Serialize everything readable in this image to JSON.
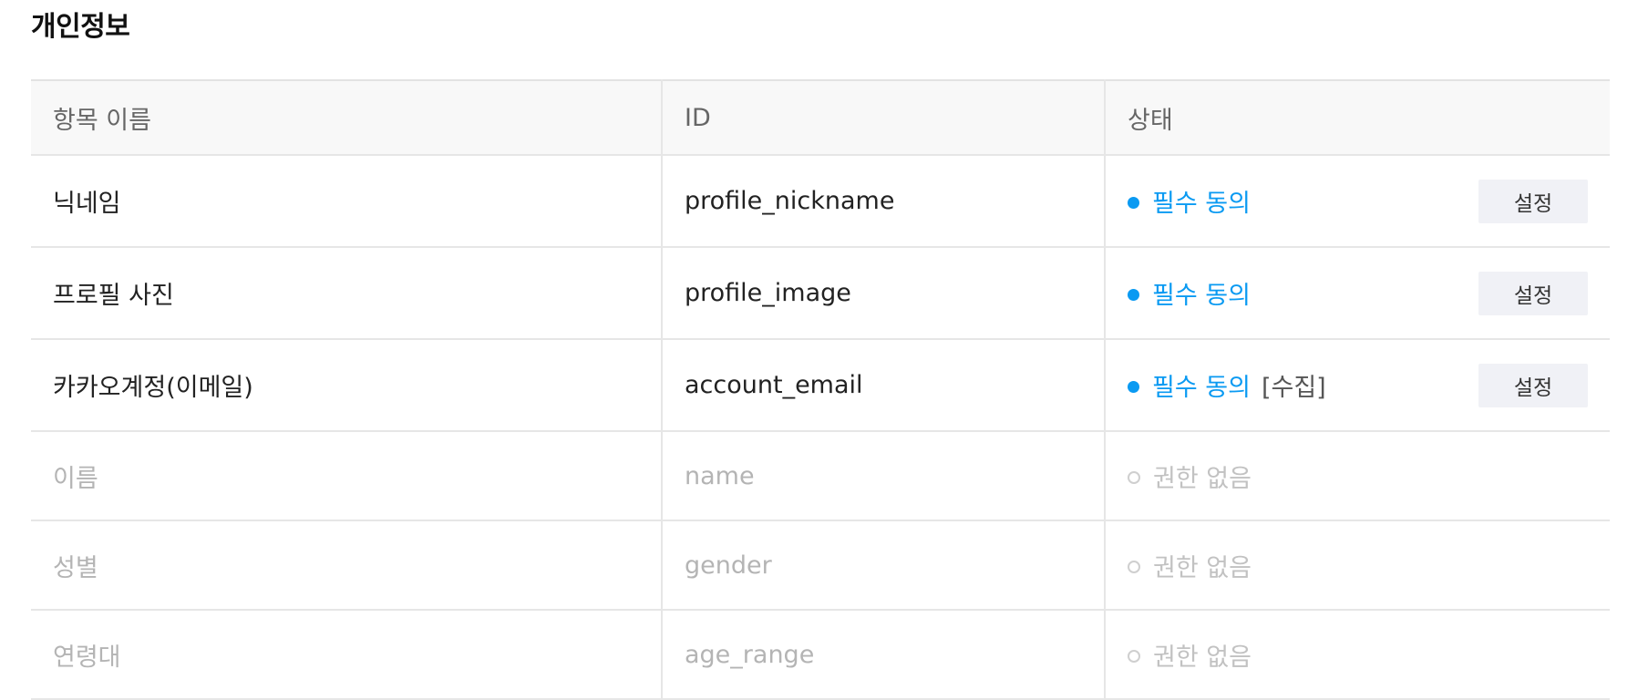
{
  "section": {
    "title": "개인정보"
  },
  "table": {
    "headers": [
      "항목 이름",
      "ID",
      "상태"
    ],
    "rows": [
      {
        "name": "닉네임",
        "id": "profile_nickname",
        "status": "필수 동의",
        "extra": "",
        "button": "설정"
      },
      {
        "name": "프로필 사진",
        "id": "profile_image",
        "status": "필수 동의",
        "extra": "",
        "button": "설정"
      },
      {
        "name": "카카오계정(이메일)",
        "id": "account_email",
        "status": "필수 동의",
        "extra": "[수집]",
        "button": "설정"
      },
      {
        "name": "이름",
        "id": "name",
        "status": "권한 없음"
      },
      {
        "name": "성별",
        "id": "gender",
        "status": "권한 없음"
      },
      {
        "name": "연령대",
        "id": "age_range",
        "status": "권한 없음"
      }
    ]
  },
  "colors": {
    "required_status": "#0a9af2",
    "disabled_text": "#b4b4b4",
    "header_background": "#f8f8f8",
    "button_background": "#f0f1f6"
  },
  "icons": {
    "required_status": "filled-dot-icon",
    "no_permission_status": "empty-circle-icon"
  }
}
